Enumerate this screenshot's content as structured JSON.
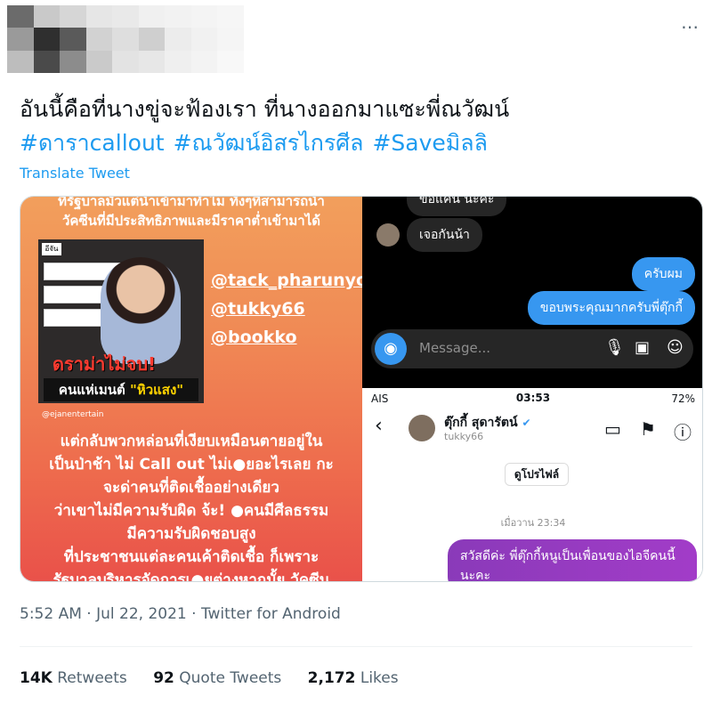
{
  "header": {
    "more_icon": "⋯",
    "avatar_blur_colors": [
      "#6b6b6b",
      "#c9c9c9",
      "#d6d6d6",
      "#e6e6e6",
      "#e9e9e9",
      "#f0f0f0",
      "#f2f2f2",
      "#f4f4f4",
      "#f6f6f6",
      "#9a9a9a",
      "#2f2f2f",
      "#5a5a5a",
      "#d2d2d2",
      "#dedede",
      "#cfcfcf",
      "#ececec",
      "#f1f1f1",
      "#f5f5f5",
      "#bdbdbd",
      "#4a4a4a",
      "#8c8c8c",
      "#cacaca",
      "#e3e3e3",
      "#e7e7e7",
      "#efefef",
      "#f3f3f3",
      "#f8f8f8"
    ]
  },
  "tweet": {
    "text_line1": "อันนี้คือที่นางขู่จะฟ้องเรา ที่นางออกมาแซะพี่ณวัฒน์",
    "hashtags": [
      "#ดาราcallout",
      "#ณวัฒน์อิสรไกรศีล",
      "#Saveมิลลิ"
    ],
    "translate_label": "Translate Tweet"
  },
  "media": {
    "left": {
      "top_text_1": "ที่รัฐบาลมัวแต่นำเข้ามาทำไม ทั้งๆที่สามารถนำ",
      "top_text_2": "วัคซีนที่มีประสิทธิภาพและมีราคาต่ำเข้ามาได้",
      "news_logo": "อีจัน",
      "handles": [
        "@tack_pharunyoo",
        "@tukky66",
        "@bookko"
      ],
      "drama_title": "ดราม่าไม่จบ!",
      "drama_sub_prefix": "คนแห่เมนต์",
      "drama_sub_highlight": "\"หิวแสง\"",
      "credit": "@ejanentertain",
      "body_lines": [
        "แต่กลับพวกหล่อนที่เงียบเหมือนตายอยู่ใน",
        "เป็นป่าช้า ไม่ Call out ไม่เ●ยอะไรเลย กะ",
        "จะด่าคนที่ติดเชื้ออย่างเดียว",
        "ว่าเขาไม่มีความรับผิด จ้ะ! ●คนมีศีลธรรม",
        "มีความรับผิดชอบสูง",
        "ที่ประชาชนแต่ละคนเค้าติดเชื้อ ก็เพราะ",
        "รัฐบาลบริหารจัดการเ●ยต่างหากมั้ย วัคซีน"
      ]
    },
    "right_top": {
      "bubble_partial": "ขอแค่นี้ นะคะ",
      "bubble_reply": "เจอกันน้า",
      "bubble_out_1": "ครับผม",
      "bubble_out_2": "ขอบพระคุณมากครับพี่ตุ๊กกี้",
      "placeholder": "Message...",
      "icons": [
        "camera-icon",
        "mic-icon",
        "image-icon",
        "sticker-icon"
      ]
    },
    "right_bottom": {
      "carrier": "AIS",
      "time": "03:53",
      "battery": "72%",
      "contact_name": "ตุ๊กกี้ สุดารัตน์",
      "contact_user": "tukky66",
      "profile_button": "ดูโปรไฟล์",
      "timestamp": "เมื่อวาน 23:34",
      "message": "สวัสดีค่ะ พี่ตุ๊กกี้หนูเป็นเพื่อนของไอจีคนนี้นะคะ"
    }
  },
  "meta": {
    "time": "5:52 AM",
    "date": "Jul 22, 2021",
    "source": "Twitter for Android"
  },
  "stats": {
    "retweets_count": "14K",
    "retweets_label": "Retweets",
    "quotes_count": "92",
    "quotes_label": "Quote Tweets",
    "likes_count": "2,172",
    "likes_label": "Likes"
  }
}
